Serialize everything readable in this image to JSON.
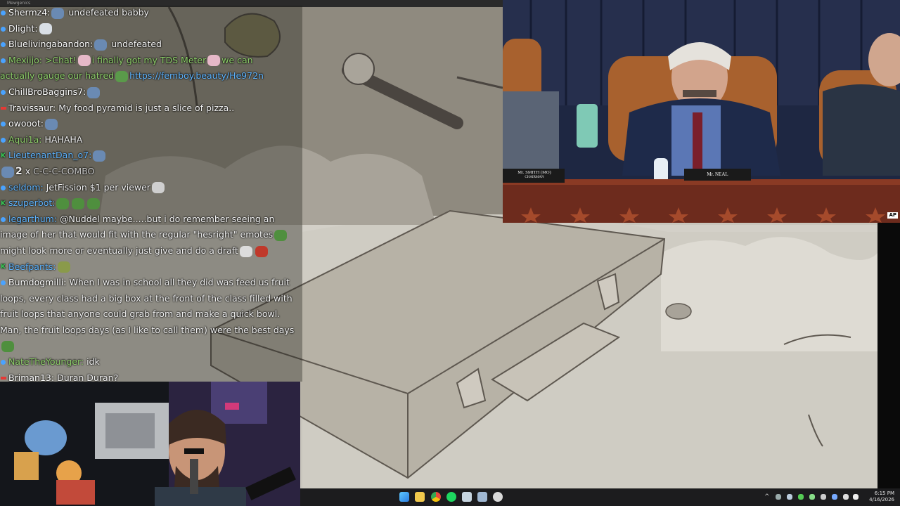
{
  "window": {
    "title": "Mewgenics"
  },
  "chat": [
    {
      "badge": "dot",
      "badge_color": "#4aa3ff",
      "user": "Shermz4",
      "user_color": "#ffffff",
      "sep": ":",
      "emotes_before": [
        "#6a8ab3"
      ],
      "text": "undefeated babby",
      "text_color": "#f1f1f1"
    },
    {
      "badge": "dot",
      "badge_color": "#4aa3ff",
      "user": "Dlight",
      "user_color": "#ffffff",
      "sep": ":",
      "emotes_after": [
        "#d9dfe6"
      ]
    },
    {
      "badge": "dot",
      "badge_color": "#4aa3ff",
      "user": "Bluelivingabandon",
      "user_color": "#ffffff",
      "sep": ":",
      "emotes_before": [
        "#6a8ab3"
      ],
      "text": "undefeated",
      "text_color": "#f1f1f1"
    },
    {
      "badge": "dot",
      "badge_color": "#4aa3ff",
      "user": "Mexiijo",
      "user_color": "#8fd06b",
      "sep": ":",
      "text": ">Chat!",
      "text_color": "#8fd06b",
      "emotes_after": [
        "#e6b8c8"
      ],
      "text2": "i finally got my TDS Meter",
      "emote2": "#e6b8c8",
      "text3": "we can"
    },
    {
      "continuation": true,
      "text": "actually gauge our hatred",
      "text_color": "#8fd06b",
      "emotes_after": [
        "#5a9a4a"
      ],
      "link": "https://femboy.beauty/He972n"
    },
    {
      "badge": "dot",
      "badge_color": "#4aa3ff",
      "user": "ChillBroBaggins7",
      "user_color": "#ffffff",
      "sep": ":",
      "emotes_after": [
        "#6a8ab3"
      ]
    },
    {
      "badge": "bar",
      "badge_color": "#e53935",
      "user": "Travissaur",
      "user_color": "#ffffff",
      "sep": ":",
      "text": "My food pyramid is just a slice of pizza..",
      "text_color": "#f1f1f1"
    },
    {
      "badge": "dot",
      "badge_color": "#4aa3ff",
      "user": "owooot",
      "user_color": "#ffffff",
      "sep": ":",
      "emotes_after": [
        "#6a8ab3"
      ]
    },
    {
      "badge": "dot",
      "badge_color": "#4aa3ff",
      "user": "Aqui1a",
      "user_color": "#8fd06b",
      "sep": ":",
      "text": "HAHAHA",
      "text_color": "#f1f1f1"
    },
    {
      "badge": "k",
      "badge_color": "#3ecf5a",
      "user": "LieutenantDan_o7",
      "user_color": "#5fb5ff",
      "sep": ":",
      "emotes_after": [
        "#6a8ab3"
      ]
    },
    {
      "combo": true,
      "count": "2",
      "mult": "x",
      "label": "C-C-C-COMBO"
    },
    {
      "badge": "dot",
      "badge_color": "#4aa3ff",
      "user": "seldom",
      "user_color": "#5fb5ff",
      "sep": ":",
      "text": "JetFission $1 per viewer",
      "text_color": "#f1f1f1",
      "emotes_after": [
        "#cfcfcf"
      ]
    },
    {
      "badge": "k",
      "badge_color": "#3ecf5a",
      "user": "szuperbot",
      "user_color": "#5fb5ff",
      "sep": ":",
      "emotes_after": [
        "#4f8f3e",
        "#4f8f3e",
        "#4f8f3e"
      ]
    },
    {
      "badge": "dot",
      "badge_color": "#4aa3ff",
      "user": "legarthum",
      "user_color": "#5fb5ff",
      "sep": ":",
      "text": "@Nuddel maybe.....but i do remember seeing an",
      "text_color": "#f1f1f1"
    },
    {
      "continuation": true,
      "text": "image of her that would fit with the regular \"hesright\" emotes",
      "text_color": "#f1f1f1",
      "emotes_after": [
        "#4f8f3e"
      ]
    },
    {
      "continuation": true,
      "text": "might look more or eventually just give and do a draft",
      "text_color": "#f1f1f1",
      "emotes_after": [
        "#dcdcdc",
        "#c0392b"
      ]
    },
    {
      "badge": "k",
      "badge_color": "#3ecf5a",
      "user": "Beefpants",
      "user_color": "#5fb5ff",
      "sep": ":",
      "emotes_after": [
        "#8a9a4a"
      ]
    },
    {
      "badge": "dot",
      "badge_color": "#4aa3ff",
      "user": "Bumdogmilli",
      "user_color": "#ffffff",
      "sep": ":",
      "text": "When I was in school all they did was feed us fruit",
      "text_color": "#f1f1f1"
    },
    {
      "continuation": true,
      "text": "loops, every class had a big box at the front of the class filled with",
      "text_color": "#f1f1f1"
    },
    {
      "continuation": true,
      "text": "fruit loops that anyone could grab from and make a quick bowl.",
      "text_color": "#f1f1f1"
    },
    {
      "continuation": true,
      "text": "Man, the fruit loops days (as I like to call them) were the best days",
      "text_color": "#f1f1f1"
    },
    {
      "continuation": true,
      "emotes_after": [
        "#4f8f3e"
      ]
    },
    {
      "badge": "dot",
      "badge_color": "#4aa3ff",
      "user": "NateTheYounger",
      "user_color": "#8fd06b",
      "sep": ":",
      "text": "idk",
      "text_color": "#f1f1f1"
    },
    {
      "badge": "bar",
      "badge_color": "#e53935",
      "user": "Briman13",
      "user_color": "#ffffff",
      "sep": ":",
      "text": "Duran Duran?",
      "text_color": "#f1f1f1"
    }
  ],
  "hearing": {
    "nameplate_left": "Mr. SMITH (MO)",
    "nameplate_left_sub": "CHAIRMAN",
    "nameplate_center": "Mr. NEAL",
    "corner_logo": "AP"
  },
  "taskbar": {
    "tray_chevron": "^",
    "clock_time": "6:15 PM",
    "clock_date": "4/16/2026",
    "icons": [
      "windows-start-icon",
      "file-explorer-icon",
      "chrome-icon",
      "spotify-icon",
      "steam-icon",
      "steam-alt-icon",
      "paw-app-icon"
    ]
  }
}
